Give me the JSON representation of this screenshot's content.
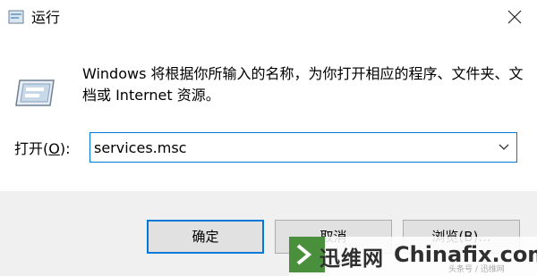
{
  "window": {
    "title": "运行",
    "close_icon": "close-icon",
    "app_icon": "run-app-icon"
  },
  "description": "Windows 将根据你所输入的名称，为你打开相应的程序、文件夹、文档或 Internet 资源。",
  "open": {
    "label_prefix": "打开(",
    "label_key": "O",
    "label_suffix": "):",
    "value": "services.msc"
  },
  "buttons": {
    "ok": "确定",
    "cancel": "取消",
    "browse": "浏览(B)..."
  },
  "watermark": {
    "cn": "迅维网",
    "en": "Chinafix.com",
    "small": "头条号 / 迅维网"
  },
  "colors": {
    "accent": "#0078d7",
    "footer_bg": "#f0f0f0",
    "button_bg": "#e1e1e1"
  }
}
